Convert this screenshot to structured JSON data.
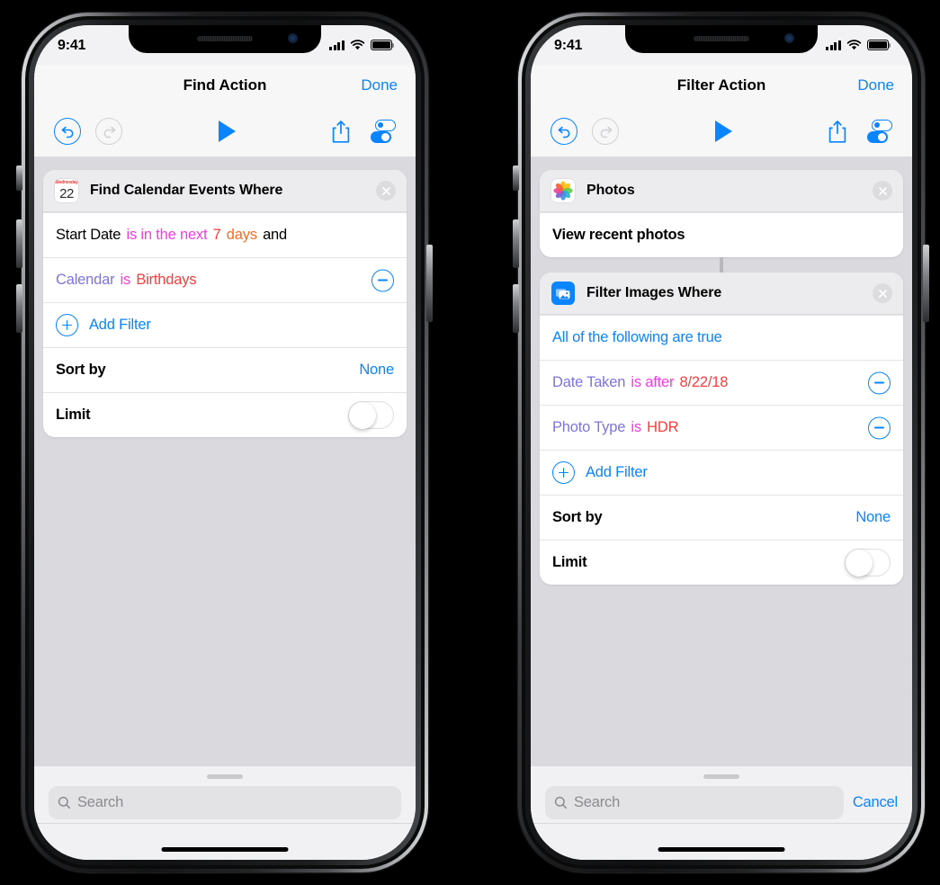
{
  "background_color": "#000000",
  "accent_color": "#0a84ff",
  "phones": [
    {
      "id": "left",
      "status": {
        "time": "9:41",
        "cellular_icon": "signal-bars-icon",
        "wifi_icon": "wifi-icon",
        "battery_icon": "battery-full-icon"
      },
      "nav": {
        "title": "Find Action",
        "done_label": "Done"
      },
      "toolbar": {
        "undo_icon": "undo-icon",
        "redo_icon": "redo-icon",
        "play_icon": "play-icon",
        "share_icon": "share-icon",
        "settings_icon": "settings-toggles-icon"
      },
      "cards": [
        {
          "icon": "calendar-icon",
          "icon_top_text": "Wednesday",
          "icon_day_text": "22",
          "title": "Find Calendar Events Where",
          "close_icon": "close-circle-icon",
          "rows": [
            {
              "type": "filter",
              "tokens": [
                {
                  "text": "Start Date",
                  "color": "black"
                },
                {
                  "text": "is in the next",
                  "color": "magenta"
                },
                {
                  "text": "7",
                  "color": "red"
                },
                {
                  "text": "days",
                  "color": "orange"
                },
                {
                  "text": "and",
                  "color": "black"
                }
              ],
              "has_minus": false
            },
            {
              "type": "filter",
              "tokens": [
                {
                  "text": "Calendar",
                  "color": "purple"
                },
                {
                  "text": "is",
                  "color": "magenta"
                },
                {
                  "text": "Birthdays",
                  "color": "red"
                }
              ],
              "has_minus": true,
              "minus_icon": "minus-circle-icon"
            },
            {
              "type": "add",
              "label": "Add Filter",
              "plus_icon": "plus-circle-icon"
            },
            {
              "type": "value",
              "label": "Sort by",
              "value": "None"
            },
            {
              "type": "toggle",
              "label": "Limit",
              "toggle_state": "off"
            }
          ]
        }
      ],
      "sheet": {
        "search_placeholder": "Search",
        "search_icon": "search-icon",
        "cancel_label": "",
        "show_cancel": false
      }
    },
    {
      "id": "right",
      "status": {
        "time": "9:41",
        "cellular_icon": "signal-bars-icon",
        "wifi_icon": "wifi-icon",
        "battery_icon": "battery-full-icon"
      },
      "nav": {
        "title": "Filter Action",
        "done_label": "Done"
      },
      "toolbar": {
        "undo_icon": "undo-icon",
        "redo_icon": "redo-icon",
        "play_icon": "play-icon",
        "share_icon": "share-icon",
        "settings_icon": "settings-toggles-icon"
      },
      "cards": [
        {
          "icon": "photos-app-icon",
          "title": "Photos",
          "close_icon": "close-circle-icon",
          "rows": [
            {
              "type": "plain",
              "label": "View recent photos"
            }
          ]
        },
        {
          "icon": "filter-images-icon",
          "title": "Filter Images Where",
          "close_icon": "close-circle-icon",
          "rows": [
            {
              "type": "condition",
              "label": "All of the following are true"
            },
            {
              "type": "filter",
              "tokens": [
                {
                  "text": "Date Taken",
                  "color": "purple"
                },
                {
                  "text": "is after",
                  "color": "magenta"
                },
                {
                  "text": "8/22/18",
                  "color": "red"
                }
              ],
              "has_minus": true,
              "minus_icon": "minus-circle-icon"
            },
            {
              "type": "filter",
              "tokens": [
                {
                  "text": "Photo Type",
                  "color": "purple"
                },
                {
                  "text": "is",
                  "color": "magenta"
                },
                {
                  "text": "HDR",
                  "color": "red"
                }
              ],
              "has_minus": true,
              "minus_icon": "minus-circle-icon"
            },
            {
              "type": "add",
              "label": "Add Filter",
              "plus_icon": "plus-circle-icon"
            },
            {
              "type": "value",
              "label": "Sort by",
              "value": "None"
            },
            {
              "type": "toggle",
              "label": "Limit",
              "toggle_state": "off"
            }
          ]
        }
      ],
      "sheet": {
        "search_placeholder": "Search",
        "search_icon": "search-icon",
        "cancel_label": "Cancel",
        "show_cancel": true
      }
    }
  ]
}
